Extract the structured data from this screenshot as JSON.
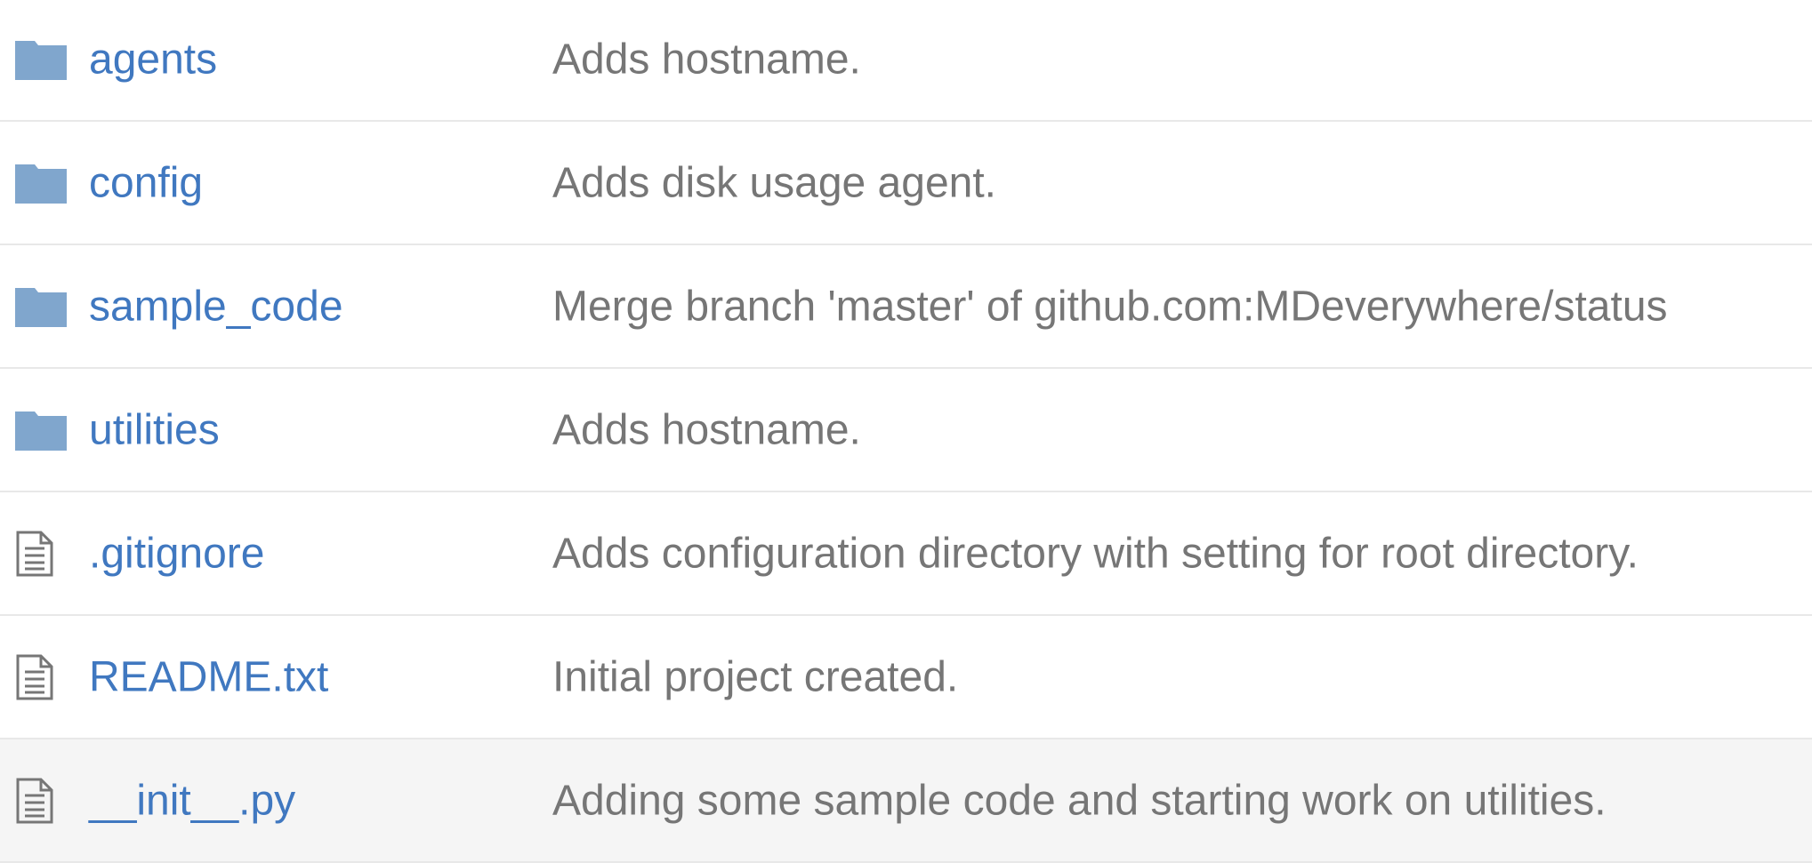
{
  "colors": {
    "link": "#4078c0",
    "message": "#767676",
    "folder_icon": "#80a6cd",
    "file_icon": "#767676",
    "divider": "#e8e8e8",
    "row_hover": "#f5f5f5"
  },
  "files": [
    {
      "type": "folder",
      "icon": "folder-icon",
      "name": "agents",
      "message": "Adds hostname."
    },
    {
      "type": "folder",
      "icon": "folder-icon",
      "name": "config",
      "message": "Adds disk usage agent."
    },
    {
      "type": "folder",
      "icon": "folder-icon",
      "name": "sample_code",
      "message": "Merge branch 'master' of github.com:MDeverywhere/status"
    },
    {
      "type": "folder",
      "icon": "folder-icon",
      "name": "utilities",
      "message": "Adds hostname."
    },
    {
      "type": "file",
      "icon": "file-text-icon",
      "name": ".gitignore",
      "message": "Adds configuration directory with setting for root directory."
    },
    {
      "type": "file",
      "icon": "file-text-icon",
      "name": "README.txt",
      "message": "Initial project created."
    },
    {
      "type": "file",
      "icon": "file-text-icon",
      "name": "__init__.py",
      "message": "Adding some sample code and starting work on utilities.",
      "hovered": true
    }
  ]
}
